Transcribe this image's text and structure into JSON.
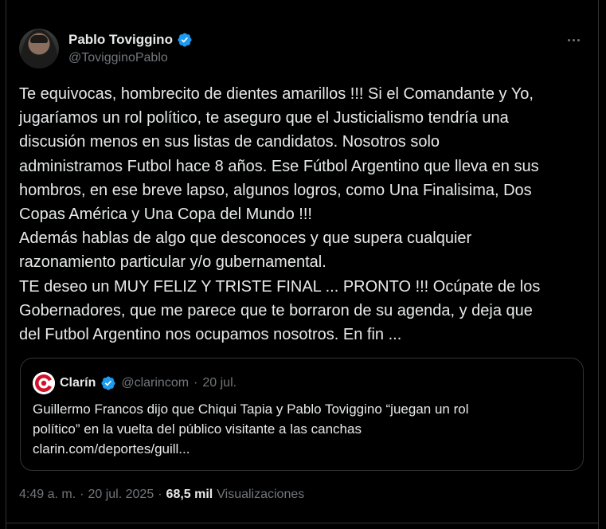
{
  "author": {
    "display_name": "Pablo Toviggino",
    "handle": "@TovigginoPablo",
    "verified": true
  },
  "icons": {
    "more": "more-horizontal-icon",
    "verified": "verified-badge-icon",
    "avatar": "profile-avatar"
  },
  "colors": {
    "verified": "#1d9bf0",
    "clarin_red": "#d2102a",
    "secondary_text": "#71767b",
    "border": "#2f3336"
  },
  "tweet": {
    "lines": [
      "Te equivocas, hombrecito de dientes amarillos !!! Si el Comandante y Yo,",
      "jugaríamos un rol político, te aseguro que el Justicialismo tendría una",
      "discusión menos en sus listas de candidatos. Nosotros solo",
      "administramos Futbol hace 8 años. Ese Fútbol Argentino que lleva en sus",
      "hombros, en ese breve lapso, algunos logros, como Una Finalisima, Dos",
      "Copas América y Una Copa del Mundo !!!",
      "Además hablas de algo que desconoces y que supera cualquier",
      "razonamiento particular y/o gubernamental.",
      "TE deseo un MUY FELIZ Y TRISTE FINAL ... PRONTO !!! Ocúpate de los",
      "Gobernadores, que me parece que te borraron de su agenda, y deja que",
      "del Futbol Argentino nos ocupamos nosotros. En fin ..."
    ]
  },
  "quote": {
    "name": "Clarín",
    "handle": "@clarincom",
    "separator": "·",
    "date": "20 jul.",
    "verified_color": "#1d9bf0",
    "lines": [
      "Guillermo Francos dijo que Chiqui Tapia y Pablo Toviggino “juegan un rol",
      "político” en la vuelta del público visitante a las canchas",
      "clarin.com/deportes/guill..."
    ]
  },
  "meta": {
    "time": "4:49 a. m.",
    "sep1": "·",
    "date": "20 jul. 2025",
    "sep2": "·",
    "views_count": "68,5 mil",
    "views_label": "Visualizaciones"
  }
}
